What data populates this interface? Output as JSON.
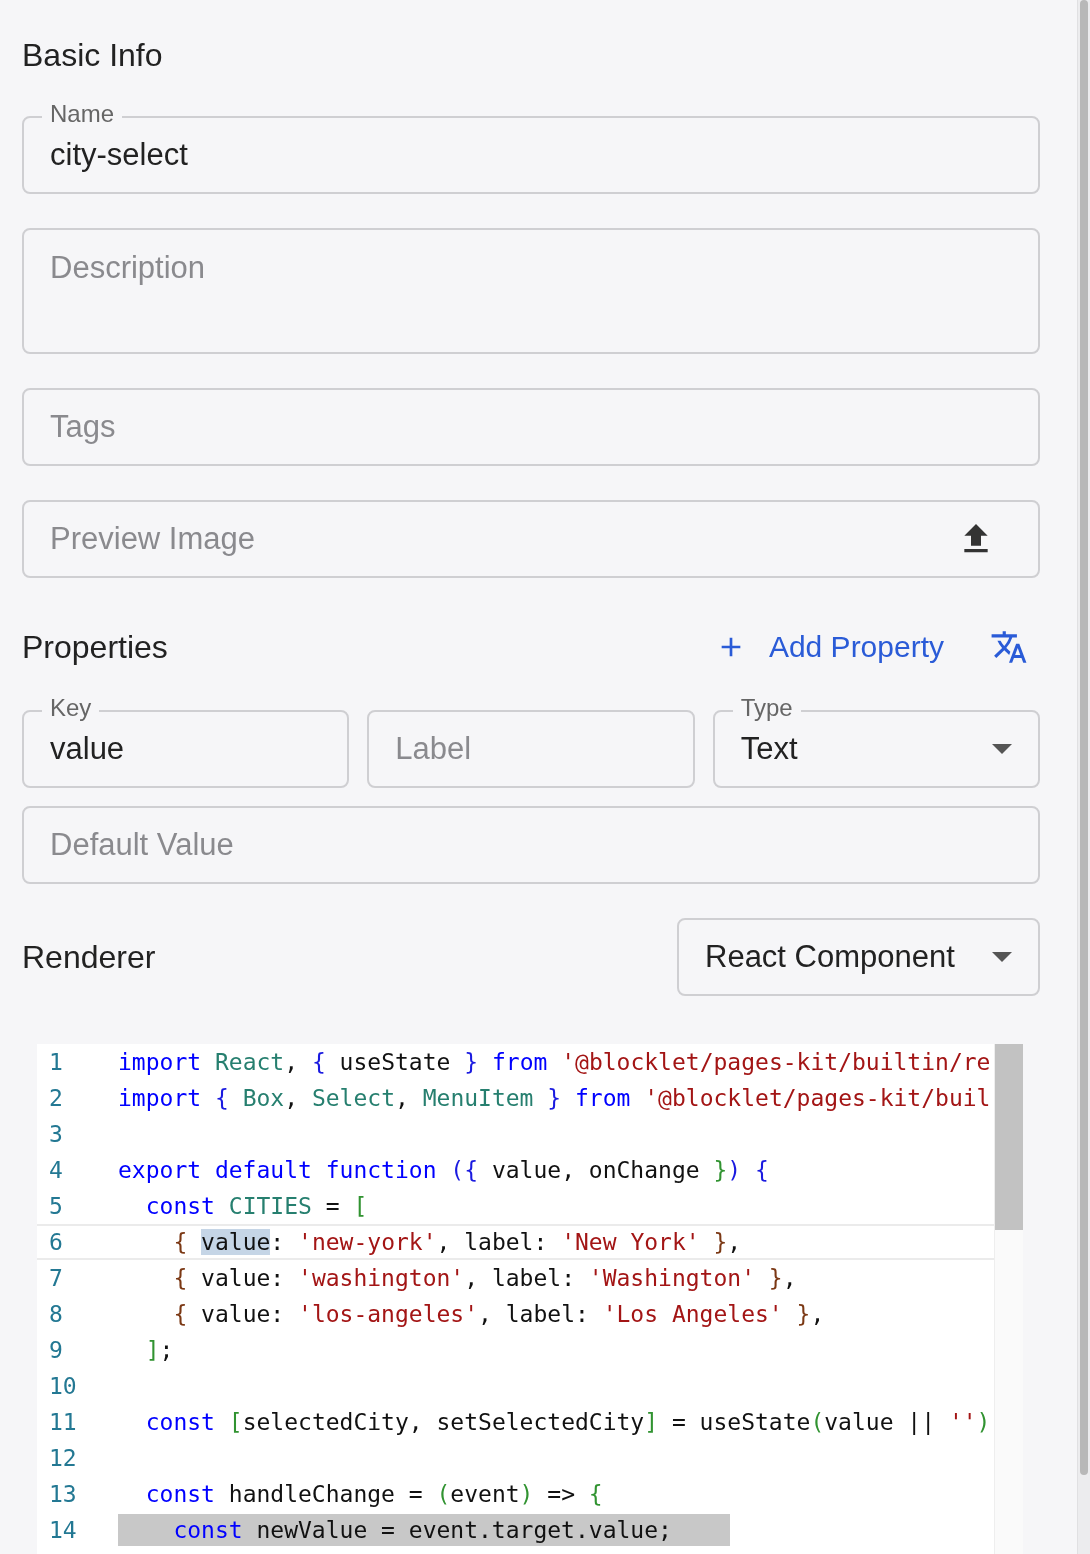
{
  "basic_info": {
    "title": "Basic Info",
    "name": {
      "label": "Name",
      "value": "city-select"
    },
    "description": {
      "placeholder": "Description"
    },
    "tags": {
      "placeholder": "Tags"
    },
    "preview_image": {
      "placeholder": "Preview Image"
    }
  },
  "properties": {
    "title": "Properties",
    "add_button": "Add Property",
    "fields": [
      {
        "kind": "text",
        "label": "Key",
        "value": "value"
      },
      {
        "kind": "text",
        "placeholder": "Label"
      },
      {
        "kind": "select",
        "label": "Type",
        "value": "Text"
      }
    ],
    "default_value": {
      "placeholder": "Default Value"
    }
  },
  "renderer": {
    "title": "Renderer",
    "select": {
      "value": "React Component"
    },
    "code": {
      "lines": [
        {
          "number": "1",
          "active": false,
          "selected": false,
          "tokens": [
            {
              "text": "import ",
              "kind": "kw"
            },
            {
              "text": "React",
              "kind": "def"
            },
            {
              "text": ", ",
              "kind": "plain"
            },
            {
              "text": "{",
              "kind": "brk1"
            },
            {
              "text": " useState ",
              "kind": "plain"
            },
            {
              "text": "} ",
              "kind": "brk1"
            },
            {
              "text": "from ",
              "kind": "kw"
            },
            {
              "text": "'@blocklet/pages-kit/builtin/re",
              "kind": "str"
            }
          ]
        },
        {
          "number": "2",
          "active": false,
          "selected": false,
          "tokens": [
            {
              "text": "import ",
              "kind": "kw"
            },
            {
              "text": "{ ",
              "kind": "brk1"
            },
            {
              "text": "Box",
              "kind": "def"
            },
            {
              "text": ", ",
              "kind": "plain"
            },
            {
              "text": "Select",
              "kind": "def"
            },
            {
              "text": ", ",
              "kind": "plain"
            },
            {
              "text": "MenuItem ",
              "kind": "def"
            },
            {
              "text": "} ",
              "kind": "brk1"
            },
            {
              "text": "from ",
              "kind": "kw"
            },
            {
              "text": "'@blocklet/pages-kit/buil",
              "kind": "str"
            }
          ]
        },
        {
          "number": "3",
          "active": false,
          "selected": false
        },
        {
          "number": "4",
          "active": false,
          "selected": false,
          "tokens": [
            {
              "text": "export default function ",
              "kind": "kw"
            },
            {
              "text": "({",
              "kind": "brk1"
            },
            {
              "text": " value, onChange ",
              "kind": "plain"
            },
            {
              "text": "}",
              "kind": "brk2"
            },
            {
              "text": ") {",
              "kind": "brk1"
            }
          ]
        },
        {
          "number": "5",
          "active": false,
          "selected": false,
          "tokens": [
            {
              "text": "  const ",
              "kind": "kw"
            },
            {
              "text": "CITIES",
              "kind": "def"
            },
            {
              "text": " = ",
              "kind": "plain"
            },
            {
              "text": "[",
              "kind": "brk2"
            }
          ]
        },
        {
          "number": "6",
          "active": true,
          "selected": false,
          "tokens": [
            {
              "text": "    { ",
              "kind": "brk3"
            },
            {
              "text": "value",
              "kind": "match"
            },
            {
              "text": ": ",
              "kind": "plain"
            },
            {
              "text": "'new-york'",
              "kind": "str"
            },
            {
              "text": ", label: ",
              "kind": "plain"
            },
            {
              "text": "'New York'",
              "kind": "str"
            },
            {
              "text": " }",
              "kind": "brk3"
            },
            {
              "text": ",",
              "kind": "plain"
            }
          ]
        },
        {
          "number": "7",
          "active": false,
          "selected": false,
          "tokens": [
            {
              "text": "    {",
              "kind": "brk3"
            },
            {
              "text": " value: ",
              "kind": "plain"
            },
            {
              "text": "'washington'",
              "kind": "str"
            },
            {
              "text": ", label: ",
              "kind": "plain"
            },
            {
              "text": "'Washington'",
              "kind": "str"
            },
            {
              "text": " }",
              "kind": "brk3"
            },
            {
              "text": ",",
              "kind": "plain"
            }
          ]
        },
        {
          "number": "8",
          "active": false,
          "selected": false,
          "tokens": [
            {
              "text": "    {",
              "kind": "brk3"
            },
            {
              "text": " value: ",
              "kind": "plain"
            },
            {
              "text": "'los-angeles'",
              "kind": "str"
            },
            {
              "text": ", label: ",
              "kind": "plain"
            },
            {
              "text": "'Los Angeles'",
              "kind": "str"
            },
            {
              "text": " }",
              "kind": "brk3"
            },
            {
              "text": ",",
              "kind": "plain"
            }
          ]
        },
        {
          "number": "9",
          "active": false,
          "selected": false,
          "tokens": [
            {
              "text": "  ]",
              "kind": "brk2"
            },
            {
              "text": ";",
              "kind": "plain"
            }
          ]
        },
        {
          "number": "10",
          "active": false,
          "selected": false
        },
        {
          "number": "11",
          "active": false,
          "selected": false,
          "tokens": [
            {
              "text": "  const ",
              "kind": "kw"
            },
            {
              "text": "[",
              "kind": "brk2"
            },
            {
              "text": "selectedCity, setSelectedCity",
              "kind": "plain"
            },
            {
              "text": "]",
              "kind": "brk2"
            },
            {
              "text": " = useState",
              "kind": "plain"
            },
            {
              "text": "(",
              "kind": "brk2"
            },
            {
              "text": "value || ",
              "kind": "plain"
            },
            {
              "text": "''",
              "kind": "str"
            },
            {
              "text": ")",
              "kind": "brk2"
            }
          ]
        },
        {
          "number": "12",
          "active": false,
          "selected": false
        },
        {
          "number": "13",
          "active": false,
          "selected": false,
          "tokens": [
            {
              "text": "  const",
              "kind": "kw"
            },
            {
              "text": " handleChange = ",
              "kind": "plain"
            },
            {
              "text": "(",
              "kind": "brk2"
            },
            {
              "text": "event",
              "kind": "plain"
            },
            {
              "text": ")",
              "kind": "brk2"
            },
            {
              "text": " => ",
              "kind": "plain"
            },
            {
              "text": "{",
              "kind": "brk2"
            }
          ]
        },
        {
          "number": "14",
          "active": false,
          "selected": true,
          "tokens": [
            {
              "text": "    const",
              "kind": "kw"
            },
            {
              "text": " newValue = event.target.value;",
              "kind": "plain"
            }
          ]
        }
      ]
    }
  }
}
